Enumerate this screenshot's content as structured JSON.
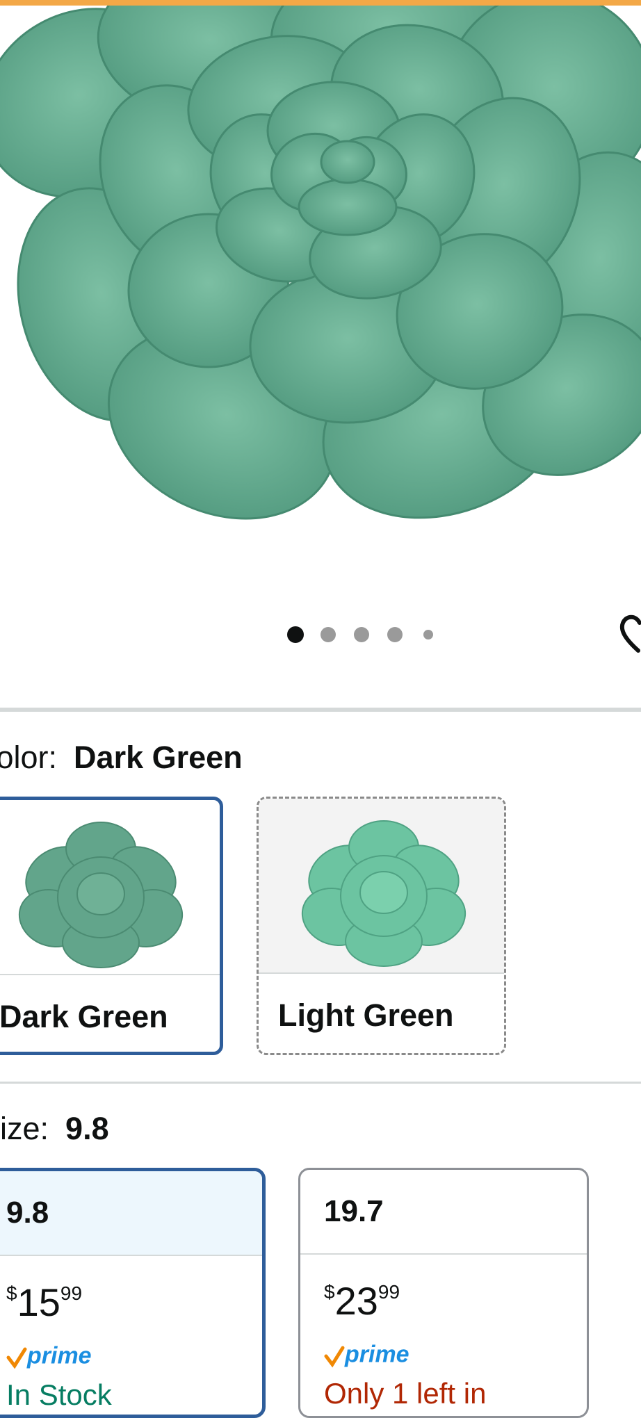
{
  "gallery": {
    "dot_count": 5,
    "active_dot": 0
  },
  "color": {
    "label": "Color:",
    "selected": "Dark Green",
    "options": [
      {
        "name": "Dark Green",
        "selected": true
      },
      {
        "name": "Light Green",
        "selected": false
      }
    ]
  },
  "size": {
    "label": "Size:",
    "selected": "9.8",
    "options": [
      {
        "name": "9.8",
        "currency": "$",
        "whole": "15",
        "fraction": "99",
        "prime": "prime",
        "availability": "In Stock",
        "availability_color": "#067d62",
        "selected": true
      },
      {
        "name": "19.7",
        "currency": "$",
        "whole": "23",
        "fraction": "99",
        "prime": "prime",
        "availability": "Only 1 left in",
        "availability_color": "#b12704",
        "selected": false
      }
    ]
  },
  "colors": {
    "accent_border": "#2e5d9a",
    "prime_blue": "#1a8ee1",
    "prime_check": "#f08804",
    "plush_green": "#5fa88c"
  }
}
